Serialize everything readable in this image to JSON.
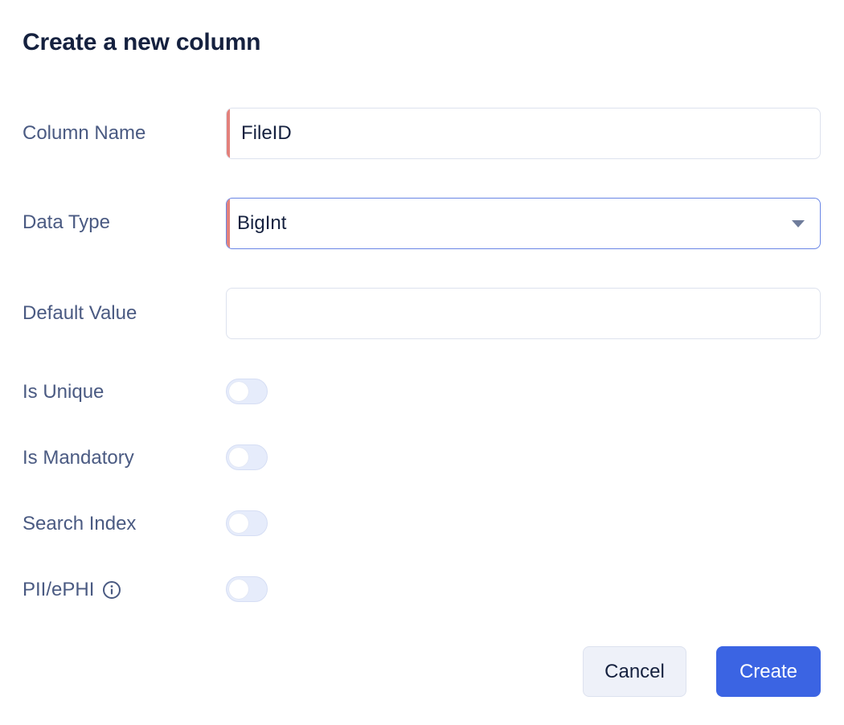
{
  "dialog": {
    "title": "Create a new column"
  },
  "form": {
    "column_name": {
      "label": "Column Name",
      "value": "FileID",
      "placeholder": ""
    },
    "data_type": {
      "label": "Data Type",
      "selected": "BigInt",
      "icon": "caret-down-icon"
    },
    "default_value": {
      "label": "Default Value",
      "value": "",
      "placeholder": ""
    },
    "toggles": [
      {
        "label": "Is Unique",
        "checked": false
      },
      {
        "label": "Is Mandatory",
        "checked": false
      },
      {
        "label": "Search Index",
        "checked": false
      },
      {
        "label": "PII/ePHI",
        "checked": false,
        "icon": "info-icon"
      }
    ]
  },
  "actions": {
    "cancel_label": "Cancel",
    "create_label": "Create"
  },
  "colors": {
    "primary": "#3b64e3",
    "invalid_marker": "#e3817b",
    "label_text": "#4a5a82",
    "title_text": "#15213f",
    "focus_border": "#6a86e6",
    "toggle_off": "#e6ecfb"
  }
}
